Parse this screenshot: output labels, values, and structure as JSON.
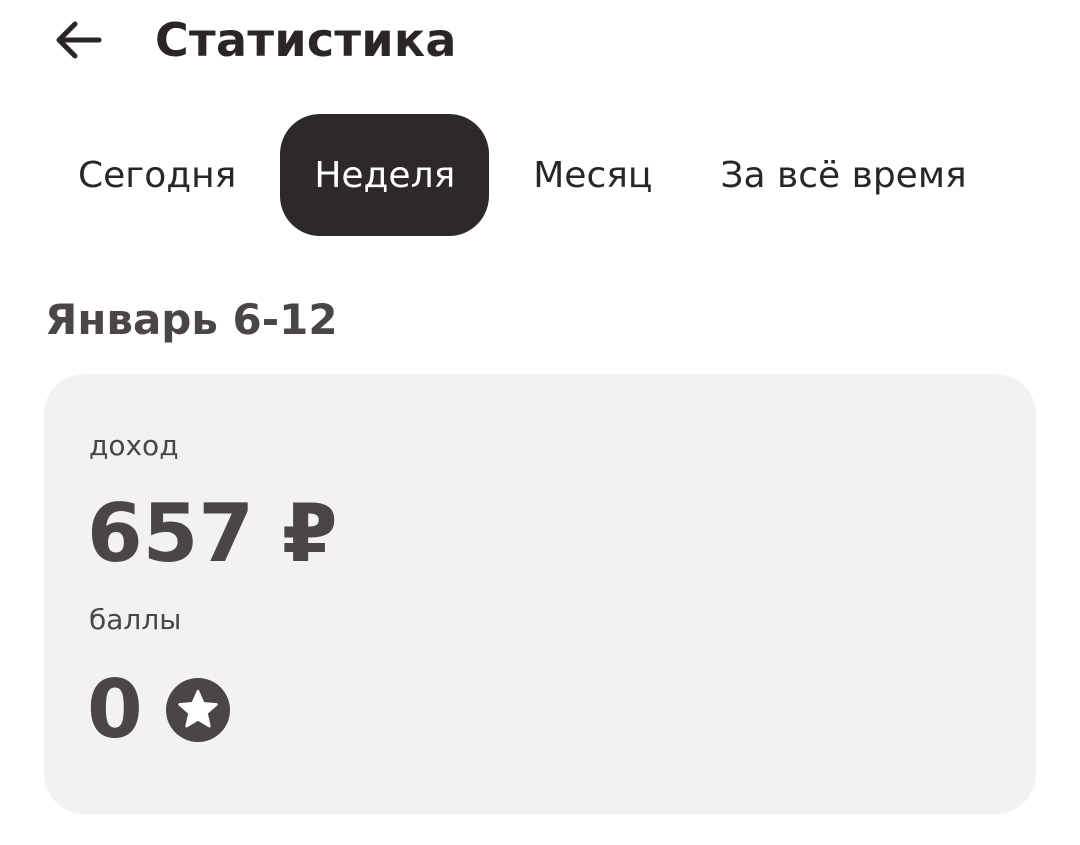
{
  "header": {
    "back_icon": "arrow-left-icon",
    "title": "Статистика"
  },
  "tabs": [
    {
      "label": "Сегодня",
      "active": false
    },
    {
      "label": "Неделя",
      "active": true
    },
    {
      "label": "Месяц",
      "active": false
    },
    {
      "label": "За всё время",
      "active": false
    }
  ],
  "period": {
    "title": "Январь 6-12"
  },
  "stats": {
    "income_label": "доход",
    "income_value": "657 ₽",
    "points_label": "баллы",
    "points_value": "0",
    "points_icon": "star-circle-icon"
  },
  "colors": {
    "text": "#2a2625",
    "muted_text": "#4b4646",
    "active_tab_bg": "#2d2928",
    "card_bg": "#f2f2f2"
  }
}
